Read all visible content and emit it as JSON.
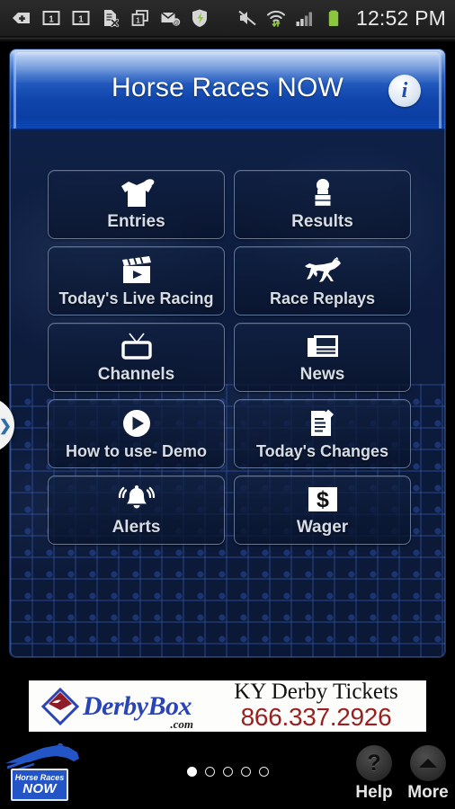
{
  "status_bar": {
    "time": "12:52 PM",
    "left_icons": [
      {
        "name": "back-arrow-plus-icon"
      },
      {
        "name": "sim1-icon",
        "label": "1"
      },
      {
        "name": "sim2-icon",
        "label": "1"
      },
      {
        "name": "document-error-icon"
      },
      {
        "name": "multi-window-icon",
        "label": "1"
      },
      {
        "name": "email-icon"
      },
      {
        "name": "security-shield-icon"
      }
    ],
    "right_icons": [
      {
        "name": "mute-icon"
      },
      {
        "name": "wifi-transfer-icon"
      },
      {
        "name": "signal-bars-icon"
      },
      {
        "name": "battery-icon"
      }
    ]
  },
  "header": {
    "title": "Horse Races NOW",
    "info_button": "i"
  },
  "grid": {
    "tiles": [
      {
        "label": "Entries",
        "icon": "jockey-silks-icon"
      },
      {
        "label": "Results",
        "icon": "podium-trophy-icon"
      },
      {
        "label": "Today's Live Racing",
        "icon": "clapperboard-play-icon"
      },
      {
        "label": "Race Replays",
        "icon": "running-horse-icon"
      },
      {
        "label": "Channels",
        "icon": "television-icon"
      },
      {
        "label": "News",
        "icon": "newspaper-icon"
      },
      {
        "label": "How to use- Demo",
        "icon": "play-circle-icon"
      },
      {
        "label": "Today's Changes",
        "icon": "document-pencil-icon"
      },
      {
        "label": "Alerts",
        "icon": "ringing-bell-icon"
      },
      {
        "label": "Wager",
        "icon": "dollar-sign-icon"
      }
    ]
  },
  "edge_tab": {
    "chevron": "❯"
  },
  "ad": {
    "logo_word": "DerbyBox",
    "logo_suffix": ".com",
    "headline": "KY Derby Tickets",
    "phone": "866.337.2926"
  },
  "bottom_bar": {
    "brand_line1": "Horse Races",
    "brand_line2": "NOW",
    "page_dots": {
      "total": 5,
      "active_index": 0
    },
    "help_label": "Help",
    "more_label": "More",
    "help_glyph": "?"
  },
  "colors": {
    "header_blue": "#1046ad",
    "panel_navy": "#0b1733",
    "accent_blue": "#2455c6",
    "phone_red": "#9a1f1f",
    "logo_blue": "#2a43b5",
    "battery_green": "#8cc63f"
  }
}
